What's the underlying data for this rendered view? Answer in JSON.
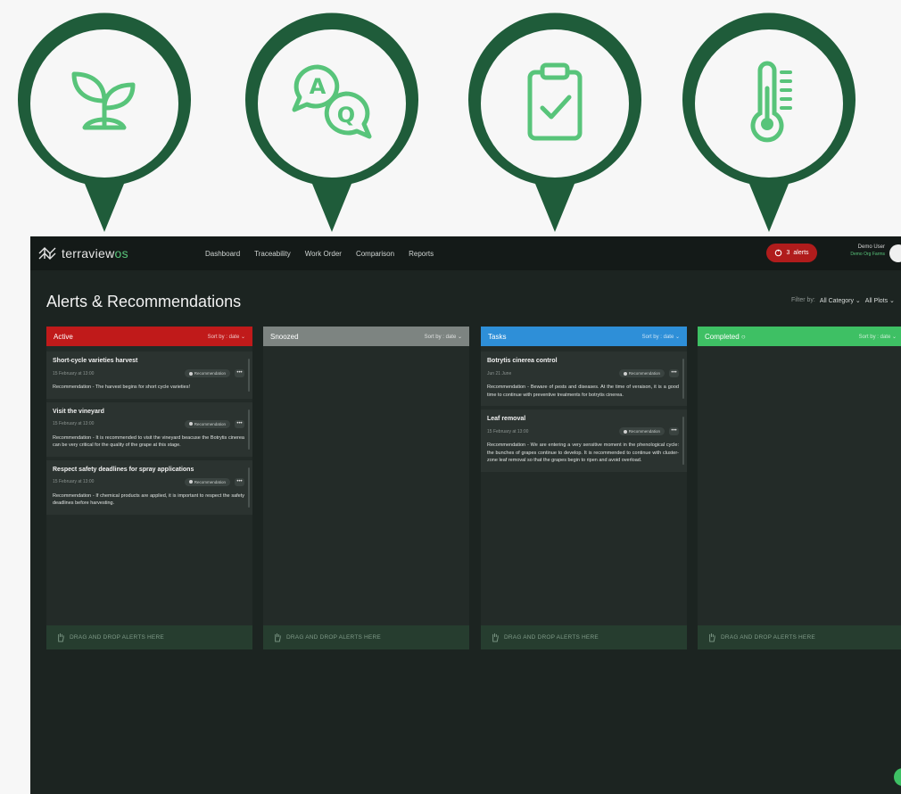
{
  "colors": {
    "pin_green": "#1f5c3a",
    "icon_green": "#58c47a",
    "active": "#c01a1a",
    "snoozed": "#7d8481",
    "tasks": "#2e8fd8",
    "completed": "#3ec064",
    "alerts_pill": "#b01c1c"
  },
  "pins": [
    {
      "icon": "seedling-icon"
    },
    {
      "icon": "qa-chat-icon"
    },
    {
      "icon": "clipboard-check-icon"
    },
    {
      "icon": "thermometer-icon"
    }
  ],
  "header": {
    "brand": "terraview",
    "brand_suffix": "os",
    "nav": [
      "Dashboard",
      "Traceability",
      "Work Order",
      "Comparison",
      "Reports"
    ],
    "alerts_count": "3",
    "alerts_label": "alerts",
    "user_name": "Demo User",
    "user_org": "Demo Org Farms"
  },
  "page": {
    "title": "Alerts & Recommendations",
    "filter_label": "Filter by:",
    "filter_category": "All Category",
    "filter_plots": "All Plots"
  },
  "columns": {
    "active": {
      "title": "Active",
      "sort": "Sort by : date",
      "cards": [
        {
          "title": "Short-cycle varieties harvest",
          "date": "15 February at 13:00",
          "badge": "Recommendation",
          "text": "Recommendation - The harvest begins for short cycle varieties!"
        },
        {
          "title": "Visit the vineyard",
          "date": "15 February at 13:00",
          "badge": "Recommendation",
          "text": "Recommendation - It is recommended to visit the vineyard beacuse the Botrytis cinerea can be very critical for the quality of the grape at this stage."
        },
        {
          "title": "Respect safety deadlines for spray applications",
          "date": "15 February at 13:00",
          "badge": "Recommendation",
          "text": "Recommendation - If chemical products are applied, it is important to respect the safety deadlines before harvesting."
        }
      ],
      "dropzone": "DRAG AND DROP ALERTS HERE"
    },
    "snoozed": {
      "title": "Snoozed",
      "sort": "Sort by : date",
      "dropzone": "DRAG AND DROP ALERTS HERE"
    },
    "tasks": {
      "title": "Tasks",
      "sort": "Sort by : date",
      "cards": [
        {
          "title": "Botrytis cinerea control",
          "date": "Jun 21 June",
          "badge": "Recommendation",
          "text": "Recommendation - Beware of pests and diseases. At the time of veraison, it is a good time to continue with preventive treatments for botrytis cinerea."
        },
        {
          "title": "Leaf removal",
          "date": "15 February at 13:00",
          "badge": "Recommendation",
          "text": "Recommendation - We are entering a very sensitive moment in the phenological cycle: the bunches of grapes continue to develop. It is recommended to continue with cluster-zone leaf removal so that the grapes begin to ripen and avoid overload."
        }
      ],
      "dropzone": "DRAG AND DROP ALERTS HERE"
    },
    "completed": {
      "title": "Completed",
      "sort": "Sort by : date",
      "dropzone": "DRAG AND DROP ALERTS HERE"
    }
  }
}
